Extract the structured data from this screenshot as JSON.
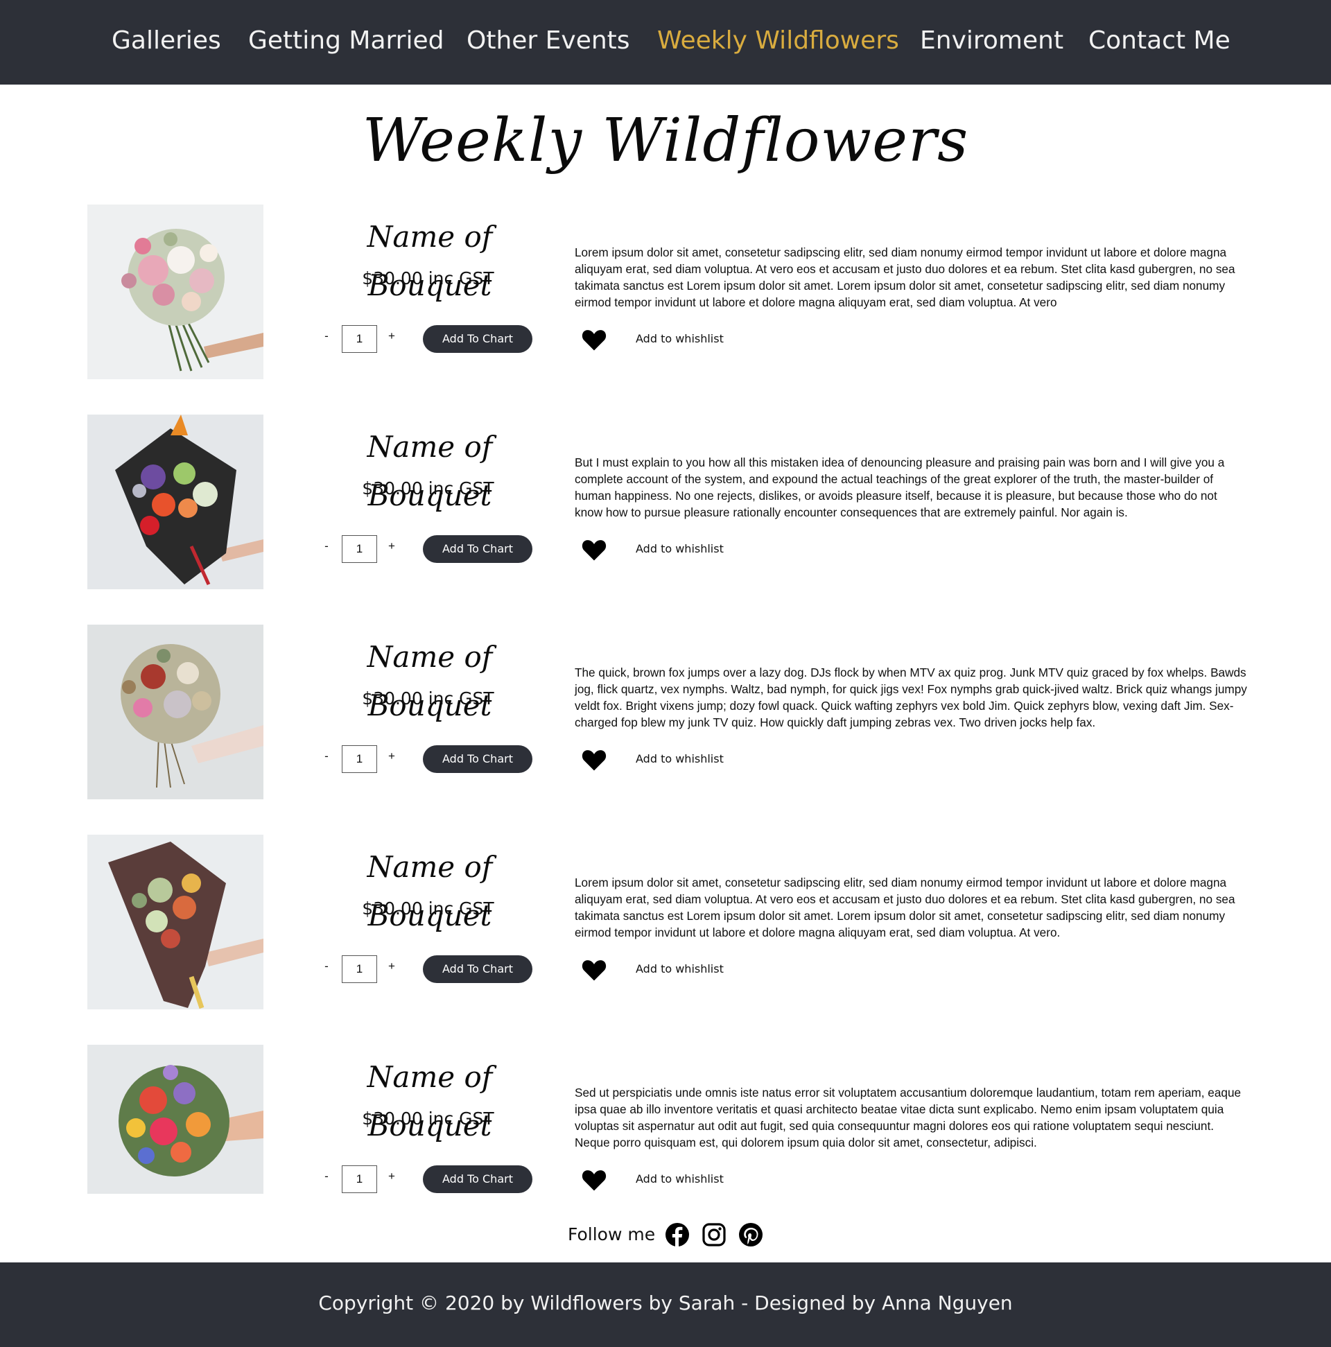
{
  "nav": {
    "items": [
      {
        "label": "Galleries"
      },
      {
        "label": "Getting Married"
      },
      {
        "label": "Other Events"
      },
      {
        "label": "Weekly Wildflowers",
        "active": true
      },
      {
        "label": "Enviroment"
      },
      {
        "label": "Contact Me"
      }
    ],
    "bg_color": "#2d3038",
    "active_color": "#d9ac3f"
  },
  "page": {
    "title": "Weekly Wildflowers"
  },
  "products": [
    {
      "name": "Name of Bouquet",
      "price": "$30.00 inc GST",
      "quantity": "1",
      "minus": "-",
      "plus": "+",
      "add_label": "Add To Chart",
      "wishlist_label": "Add to whishlist",
      "description": "Lorem ipsum dolor sit amet, consetetur sadipscing elitr, sed diam nonumy eirmod tempor invidunt ut labore et dolore magna aliquyam erat, sed diam voluptua. At vero eos et accusam et justo duo dolores et ea rebum. Stet clita kasd gubergren, no sea takimata sanctus est Lorem ipsum dolor sit amet. Lorem ipsum dolor sit amet, consetetur sadipscing elitr, sed diam nonumy eirmod tempor invidunt ut labore et dolore magna aliquyam erat, sed diam voluptua. At vero"
    },
    {
      "name": "Name of Bouquet",
      "price": "$30.00 inc GST",
      "quantity": "1",
      "minus": "-",
      "plus": "+",
      "add_label": "Add To Chart",
      "wishlist_label": "Add to whishlist",
      "description": "But I must explain to you how all this mistaken idea of denouncing pleasure and praising pain was born and I will give you a complete account of the system, and expound the actual teachings of the great explorer of the truth, the master-builder of human happiness. No one rejects, dislikes, or avoids pleasure itself, because it is pleasure, but because those who do not know how to pursue pleasure rationally encounter consequences that are extremely painful. Nor again is."
    },
    {
      "name": "Name of Bouquet",
      "price": "$30.00 inc GST",
      "quantity": "1",
      "minus": "-",
      "plus": "+",
      "add_label": "Add To Chart",
      "wishlist_label": "Add to whishlist",
      "description": "The quick, brown fox jumps over a lazy dog. DJs flock by when MTV ax quiz prog. Junk MTV quiz graced by fox whelps. Bawds jog, flick quartz, vex nymphs. Waltz, bad nymph, for quick jigs vex! Fox nymphs grab quick-jived waltz. Brick quiz whangs jumpy veldt fox. Bright vixens jump; dozy fowl quack. Quick wafting zephyrs vex bold Jim. Quick zephyrs blow, vexing daft Jim. Sex-charged fop blew my junk TV quiz. How quickly daft jumping zebras vex. Two driven jocks help fax."
    },
    {
      "name": "Name of Bouquet",
      "price": "$30.00 inc GST",
      "quantity": "1",
      "minus": "-",
      "plus": "+",
      "add_label": "Add To Chart",
      "wishlist_label": "Add to whishlist",
      "description": "Lorem ipsum dolor sit amet, consetetur sadipscing elitr, sed diam nonumy eirmod tempor invidunt ut labore et dolore magna aliquyam erat, sed diam voluptua. At vero eos et accusam et justo duo dolores et ea rebum. Stet clita kasd gubergren, no sea takimata sanctus est Lorem ipsum dolor sit amet. Lorem ipsum dolor sit amet, consetetur sadipscing elitr, sed diam nonumy eirmod tempor invidunt ut labore et dolore magna aliquyam erat, sed diam voluptua. At vero."
    },
    {
      "name": "Name of Bouquet",
      "price": "$30.00 inc GST",
      "quantity": "1",
      "minus": "-",
      "plus": "+",
      "add_label": "Add To Chart",
      "wishlist_label": "Add to whishlist",
      "description": "Sed ut perspiciatis unde omnis iste natus error sit voluptatem accusantium doloremque laudantium, totam rem aperiam, eaque ipsa quae ab illo inventore veritatis et quasi architecto beatae vitae dicta sunt explicabo. Nemo enim ipsam voluptatem quia voluptas sit aspernatur aut odit aut fugit, sed quia consequuntur magni dolores eos qui ratione voluptatem sequi nesciunt. Neque porro quisquam est, qui dolorem ipsum quia dolor sit amet, consectetur, adipisci."
    }
  ],
  "follow": {
    "label": "Follow me",
    "icons": [
      "facebook-icon",
      "instagram-icon",
      "pinterest-icon"
    ]
  },
  "footer": {
    "copyright": "Copyright © 2020 by Wildflowers by Sarah - Designed by Anna Nguyen"
  }
}
